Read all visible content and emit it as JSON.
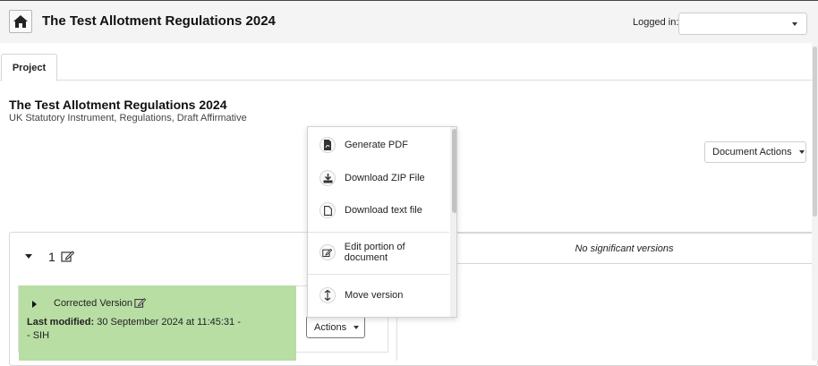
{
  "header": {
    "title": "The Test Allotment Regulations 2024",
    "logged_in_label": "Logged in:",
    "logged_in_value": ""
  },
  "tabs": [
    {
      "label": "Project"
    }
  ],
  "document": {
    "title": "The Test Allotment Regulations 2024",
    "subtitle": "UK Statutory Instrument, Regulations, Draft Affirmative",
    "actions_label": "Document Actions"
  },
  "version_group": {
    "number": "1",
    "no_versions_text": "No significant versions"
  },
  "version": {
    "name": "Corrected Version",
    "last_modified_label": "Last modified:",
    "last_modified_value": "30 September 2024 at 11:45:31 -",
    "author": "- SIH",
    "actions_label": "Actions"
  },
  "actions_menu": {
    "items": [
      {
        "label": "Generate PDF",
        "icon": "pdf-file-icon"
      },
      {
        "label": "Download ZIP File",
        "icon": "download-icon"
      },
      {
        "label": "Download text file",
        "icon": "file-icon"
      },
      {
        "label": "Edit portion of document",
        "icon": "edit-icon"
      },
      {
        "label": "Move version",
        "icon": "move-vertical-icon"
      }
    ]
  },
  "colors": {
    "version_highlight": "#b8dea4",
    "header_bg": "#f4f4f4"
  }
}
